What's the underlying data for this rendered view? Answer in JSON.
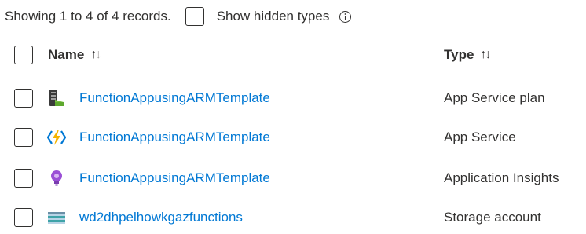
{
  "summary": {
    "records_text": "Showing 1 to 4 of 4 records.",
    "show_hidden_label": "Show hidden types"
  },
  "table": {
    "columns": [
      {
        "label": "Name",
        "sort_icon": "sort-up-down-icon"
      },
      {
        "label": "Type",
        "sort_icon": "sort-up-down-icon"
      }
    ],
    "rows": [
      {
        "name": "FunctionAppusingARMTemplate",
        "type": "App Service plan",
        "icon": "app-service-plan-icon"
      },
      {
        "name": "FunctionAppusingARMTemplate",
        "type": "App Service",
        "icon": "function-app-icon"
      },
      {
        "name": "FunctionAppusingARMTemplate",
        "type": "Application Insights",
        "icon": "application-insights-icon"
      },
      {
        "name": "wd2dhpelhowkgazfunctions",
        "type": "Storage account",
        "icon": "storage-account-icon"
      }
    ]
  },
  "colors": {
    "link": "#0078d4",
    "text": "#323130"
  }
}
